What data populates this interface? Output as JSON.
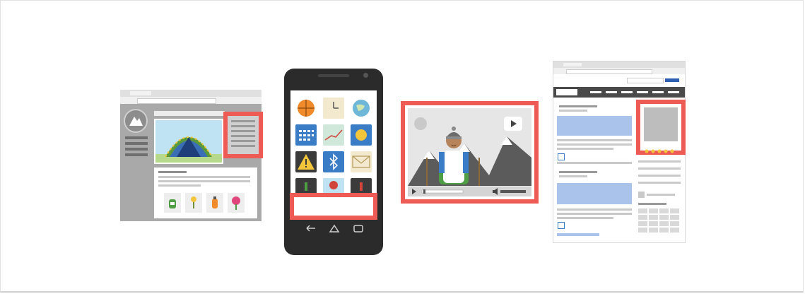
{
  "illustration": {
    "description_free": true,
    "ad_formats": [
      "desktop-sidebar-ad",
      "mobile-banner-ad",
      "video-ad",
      "web-page-sidebar-ad"
    ],
    "colors": {
      "highlight": "#ee5b54",
      "browser_chrome": "#d8d8d8",
      "panel_gray": "#a7a7a7",
      "sky_blue": "#bfe3f3",
      "phone_body": "#2b2b2b",
      "blue_bar": "#a9c3ea",
      "star": "#f3c53b"
    },
    "icons": [
      "mountain-logo-icon",
      "tent-icon",
      "backpack-icon",
      "lamp-icon",
      "bottle-icon",
      "rose-icon",
      "basketball-icon",
      "clock-icon",
      "globe-icon",
      "calendar-icon",
      "chart-icon",
      "sun-icon",
      "warning-icon",
      "bluetooth-icon",
      "mail-icon",
      "play-icon",
      "volume-icon",
      "back-icon",
      "home-icon",
      "recents-icon"
    ]
  }
}
